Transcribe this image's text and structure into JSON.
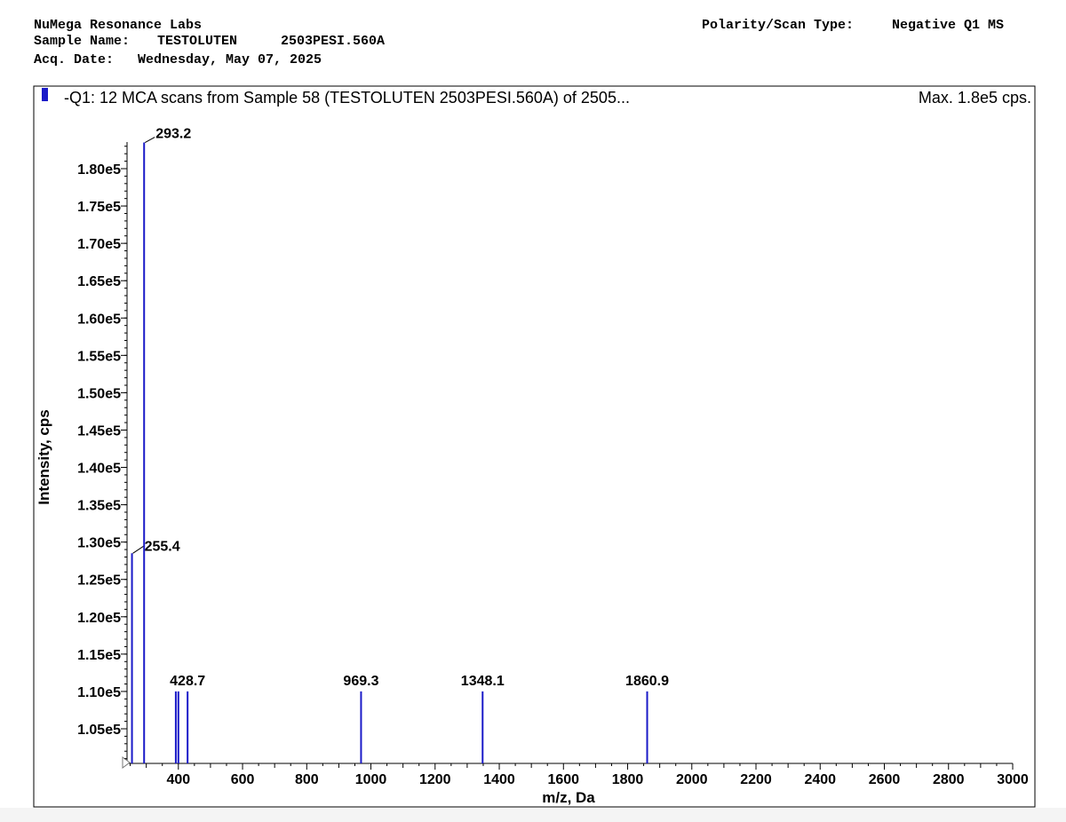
{
  "header": {
    "lab": "NuMega Resonance Labs",
    "sample_label": "Sample Name:",
    "sample_name": "TESTOLUTEN",
    "sample_id": "2503PESI.560A",
    "acq_label": "Acq. Date:",
    "acq_date": "Wednesday, May 07, 2025",
    "polarity_label": "Polarity/Scan Type:",
    "polarity": "Negative Q1 MS"
  },
  "colors": {
    "peak": "#1a1ac8",
    "frame": "#000000"
  },
  "chart_data": {
    "type": "bar",
    "title": "-Q1: 12 MCA scans from Sample 58 (TESTOLUTEN   2503PESI.560A) of 2505...",
    "max_label": "Max. 1.8e5 cps.",
    "xlabel": "m/z, Da",
    "ylabel": "Intensity, cps",
    "xlim": [
      240,
      3000
    ],
    "ylim": [
      100000,
      186000
    ],
    "x_ticks": [
      400,
      600,
      800,
      1000,
      1200,
      1400,
      1600,
      1800,
      2000,
      2200,
      2400,
      2600,
      2800,
      3000
    ],
    "y_ticks": [
      {
        "value": 105000,
        "label": "1.05e5"
      },
      {
        "value": 110000,
        "label": "1.10e5"
      },
      {
        "value": 115000,
        "label": "1.15e5"
      },
      {
        "value": 120000,
        "label": "1.20e5"
      },
      {
        "value": 125000,
        "label": "1.25e5"
      },
      {
        "value": 130000,
        "label": "1.30e5"
      },
      {
        "value": 135000,
        "label": "1.35e5"
      },
      {
        "value": 140000,
        "label": "1.40e5"
      },
      {
        "value": 145000,
        "label": "1.45e5"
      },
      {
        "value": 150000,
        "label": "1.50e5"
      },
      {
        "value": 155000,
        "label": "1.55e5"
      },
      {
        "value": 160000,
        "label": "1.60e5"
      },
      {
        "value": 165000,
        "label": "1.65e5"
      },
      {
        "value": 170000,
        "label": "1.70e5"
      },
      {
        "value": 175000,
        "label": "1.75e5"
      },
      {
        "value": 180000,
        "label": "1.80e5"
      }
    ],
    "peaks": [
      {
        "mz": 255.4,
        "intensity": 128500,
        "label": "255.4"
      },
      {
        "mz": 293.2,
        "intensity": 183500,
        "label": "293.2"
      },
      {
        "mz": 392,
        "intensity": 110000,
        "label": ""
      },
      {
        "mz": 400,
        "intensity": 110000,
        "label": ""
      },
      {
        "mz": 428.7,
        "intensity": 110000,
        "label": "428.7"
      },
      {
        "mz": 969.3,
        "intensity": 110000,
        "label": "969.3"
      },
      {
        "mz": 1348.1,
        "intensity": 110000,
        "label": "1348.1"
      },
      {
        "mz": 1860.9,
        "intensity": 110000,
        "label": "1860.9"
      }
    ]
  }
}
